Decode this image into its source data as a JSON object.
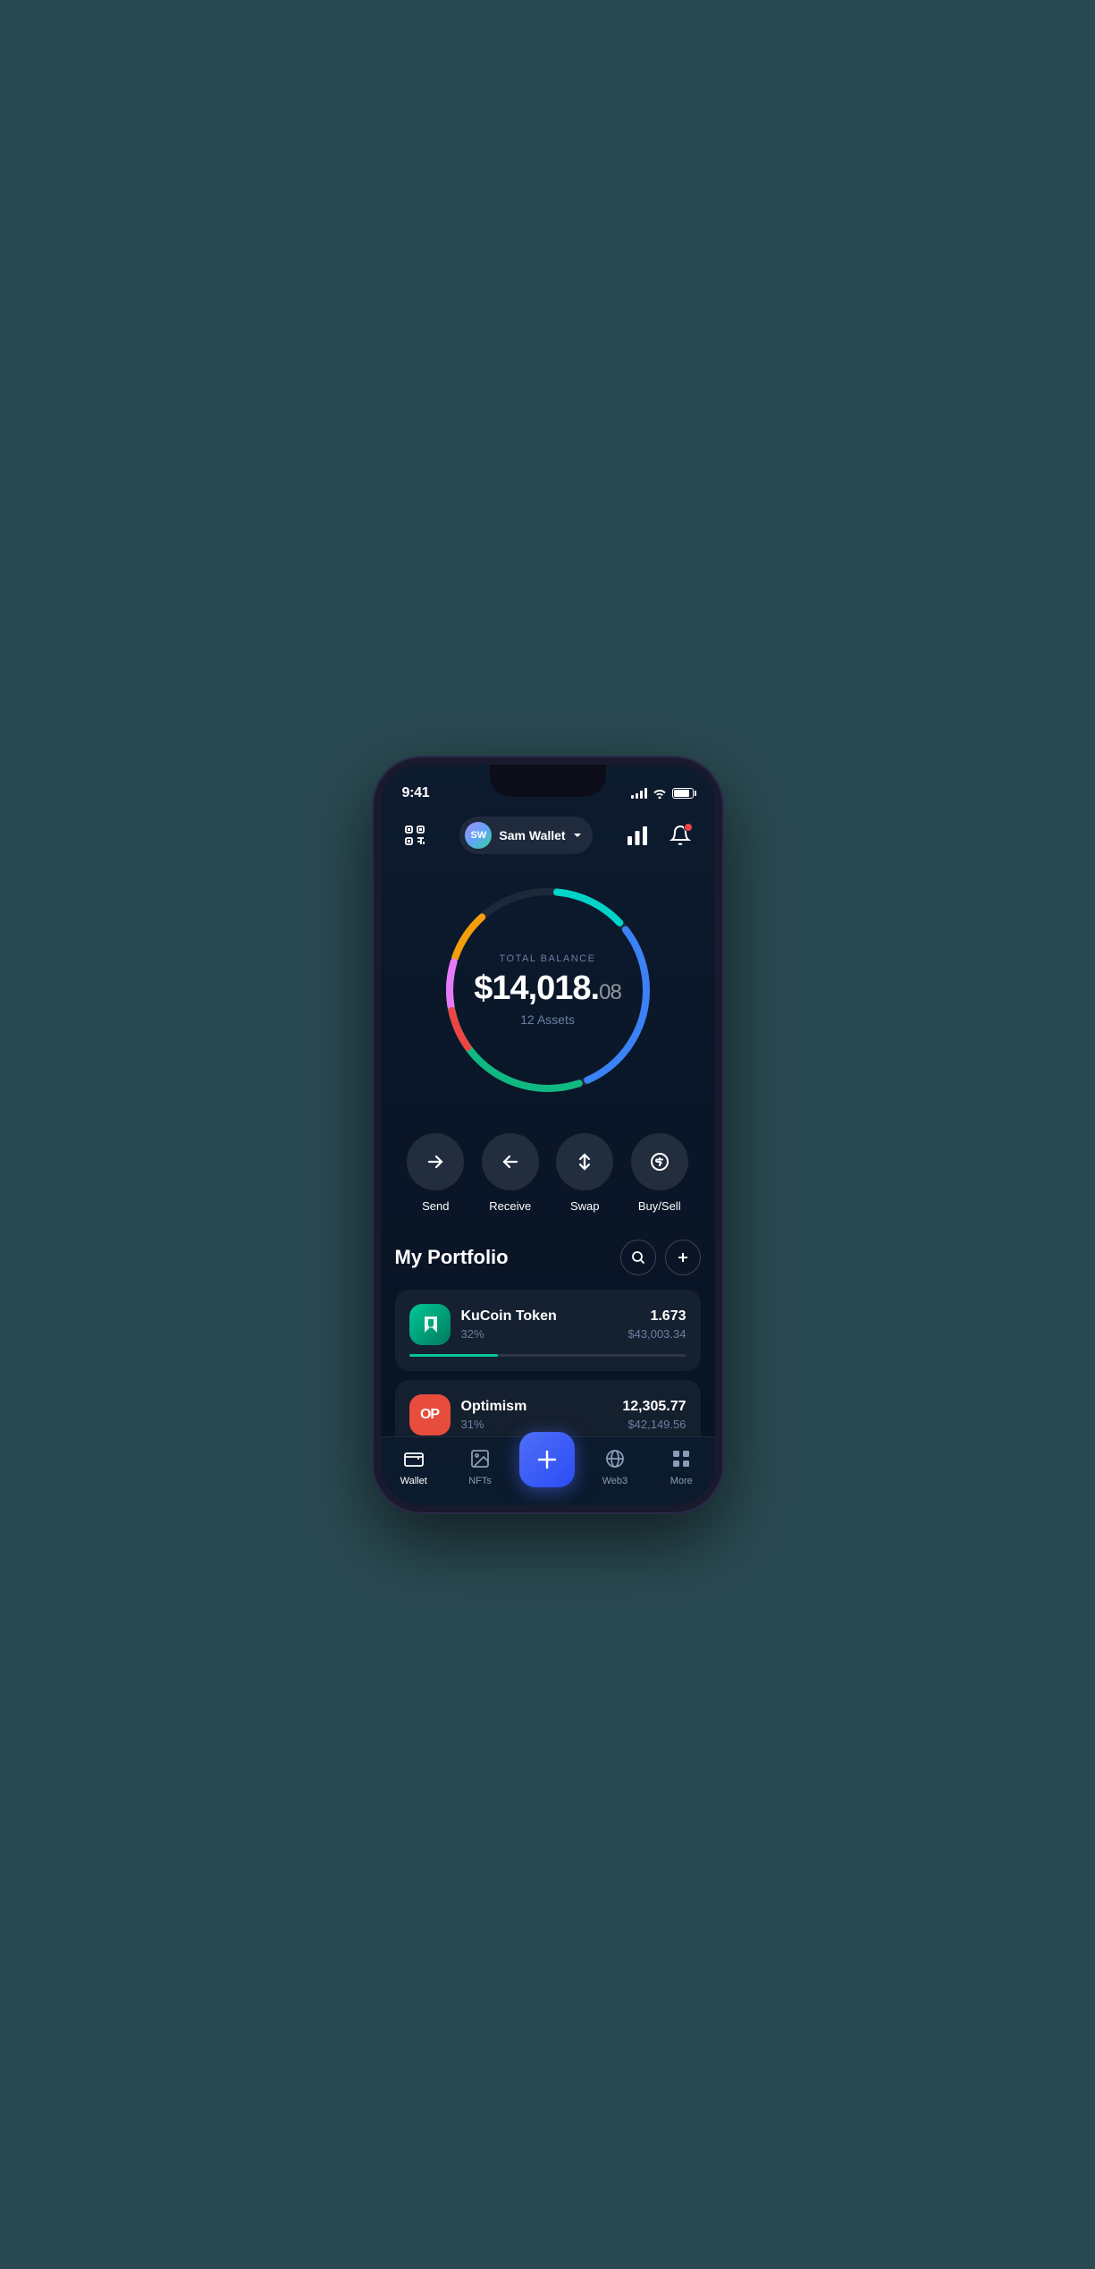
{
  "statusBar": {
    "time": "9:41"
  },
  "header": {
    "avatarText": "SW",
    "walletName": "Sam Wallet",
    "scanIconLabel": "scan-icon",
    "chartIconLabel": "chart-icon",
    "notificationIconLabel": "notification-icon"
  },
  "balance": {
    "label": "TOTAL BALANCE",
    "wholePart": "$14,018.",
    "centsPart": "08",
    "assetsCount": "12 Assets"
  },
  "actions": [
    {
      "id": "send",
      "label": "Send"
    },
    {
      "id": "receive",
      "label": "Receive"
    },
    {
      "id": "swap",
      "label": "Swap"
    },
    {
      "id": "buysell",
      "label": "Buy/Sell"
    }
  ],
  "portfolio": {
    "title": "My Portfolio",
    "assets": [
      {
        "id": "kucoin",
        "name": "KuCoin Token",
        "percentage": "32%",
        "amount": "1.673",
        "usdValue": "$43,003.34",
        "progressWidth": 32,
        "progressColor": "#00c896"
      },
      {
        "id": "optimism",
        "name": "Optimism",
        "percentage": "31%",
        "amount": "12,305.77",
        "usdValue": "$42,149.56",
        "progressWidth": 31,
        "progressColor": "#e74c3c"
      }
    ]
  },
  "bottomNav": [
    {
      "id": "wallet",
      "label": "Wallet",
      "active": true
    },
    {
      "id": "nfts",
      "label": "NFTs",
      "active": false
    },
    {
      "id": "center",
      "label": "",
      "active": false
    },
    {
      "id": "web3",
      "label": "Web3",
      "active": false
    },
    {
      "id": "more",
      "label": "More",
      "active": false
    }
  ]
}
